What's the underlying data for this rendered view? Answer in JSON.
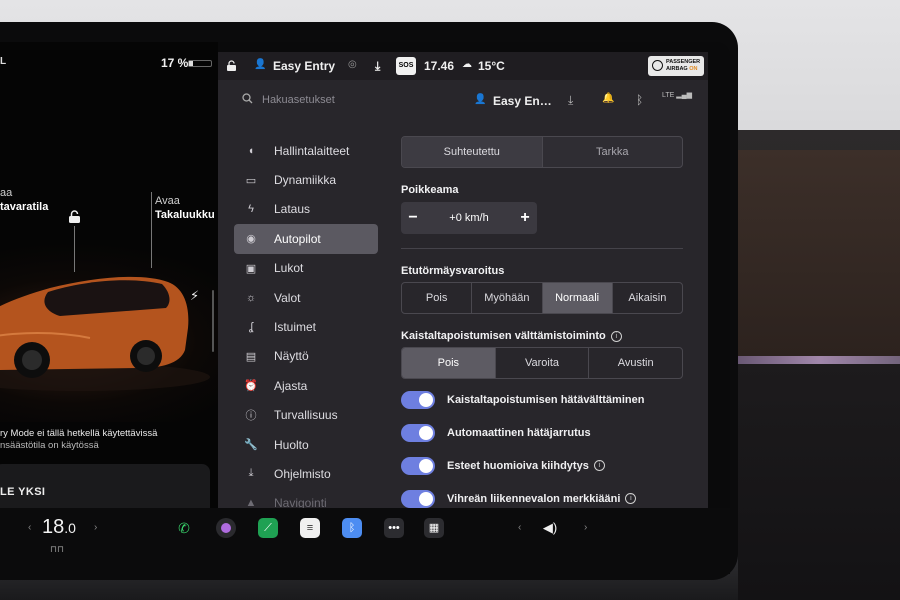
{
  "car": {
    "status_left": "L",
    "battery_percent": "17 %",
    "battery_level": 0.17,
    "label_frunk_1": "aa",
    "label_frunk_2": "tavaratila",
    "label_trunk_1": "Avaa",
    "label_trunk_2": "Takaluukku",
    "notice_1": "ry Mode ei tällä hetkellä käytettävissä",
    "notice_2": "nsäästötila on käytössä",
    "car_color": "#b4541e"
  },
  "media": {
    "title": "LE YKSI",
    "controls": [
      "next-icon",
      "star-icon",
      "equalizer-icon",
      "search-icon"
    ]
  },
  "topbar": {
    "profile": "Easy Entry",
    "sos": "SOS",
    "time": "17.46",
    "weather": "15°C",
    "airbag_1": "PASSENGER",
    "airbag_2": "AIRBAG",
    "airbag_3": "ON",
    "accent": "#f2a340"
  },
  "search": {
    "placeholder": "Hakuasetukset",
    "profile_short": "Easy En…",
    "signal": "LTE"
  },
  "nav": {
    "items": [
      {
        "label": "Hallintalaitteet",
        "icon": "toggle-icon"
      },
      {
        "label": "Dynamiikka",
        "icon": "car-icon"
      },
      {
        "label": "Lataus",
        "icon": "bolt-icon"
      },
      {
        "label": "Autopilot",
        "icon": "steering-wheel-icon"
      },
      {
        "label": "Lukot",
        "icon": "lock-icon"
      },
      {
        "label": "Valot",
        "icon": "sun-icon"
      },
      {
        "label": "Istuimet",
        "icon": "seat-icon"
      },
      {
        "label": "Näyttö",
        "icon": "display-icon"
      },
      {
        "label": "Ajasta",
        "icon": "alarm-icon"
      },
      {
        "label": "Turvallisuus",
        "icon": "info-circle-icon"
      },
      {
        "label": "Huolto",
        "icon": "wrench-icon"
      },
      {
        "label": "Ohjelmisto",
        "icon": "download-icon"
      },
      {
        "label": "Navigointi",
        "icon": "navigation-icon"
      }
    ],
    "active": "Autopilot"
  },
  "content": {
    "mode_tabs": [
      "Suhteutettu",
      "Tarkka"
    ],
    "mode_selected": "Suhteutettu",
    "offset_title": "Poikkeama",
    "offset_value": "+0 km/h",
    "fcw_title": "Etutörmäysvaroitus",
    "fcw_options": [
      "Pois",
      "Myöhään",
      "Normaali",
      "Aikaisin"
    ],
    "fcw_selected": "Normaali",
    "lane_title": "Kaistaltapoistumisen välttämistoiminto",
    "lane_options": [
      "Pois",
      "Varoita",
      "Avustin"
    ],
    "lane_selected": "Pois",
    "toggles": [
      {
        "label": "Kaistaltapoistumisen hätävälttäminen",
        "on": true,
        "info": false
      },
      {
        "label": "Automaattinen hätäjarrutus",
        "on": true,
        "info": false
      },
      {
        "label": "Esteet huomioiva kiihdytys",
        "on": true,
        "info": true
      },
      {
        "label": "Vihreän liikennevalon merkkiääni",
        "on": true,
        "info": true
      }
    ],
    "toggle_color": "#6e7fe0"
  },
  "dock": {
    "temperature": "18",
    "temperature_decimal": ".0",
    "icons": [
      "phone-icon",
      "camera-icon",
      "energy-app-icon",
      "notes-icon",
      "bluetooth-icon",
      "more-icon",
      "dashcam-icon"
    ],
    "volume_icon": "speaker-icon"
  }
}
